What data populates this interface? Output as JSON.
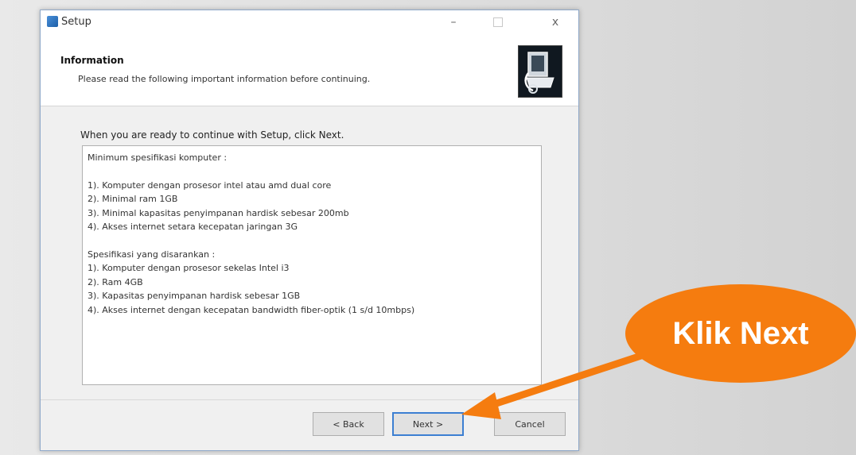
{
  "window": {
    "title": "Setup",
    "minimize": "–",
    "close": "x"
  },
  "header": {
    "title": "Information",
    "subtitle": "Please read the following important information before continuing."
  },
  "body": {
    "instruction": "When you are ready to continue with Setup, click Next.",
    "info_lines": [
      "Minimum spesifikasi komputer :",
      "",
      "1). Komputer dengan prosesor intel atau amd dual core",
      "2). Minimal ram 1GB",
      "3). Minimal kapasitas penyimpanan hardisk sebesar 200mb",
      "4). Akses internet setara kecepatan jaringan 3G",
      "",
      "Spesifikasi yang disarankan :",
      "1). Komputer dengan prosesor sekelas Intel i3",
      "2). Ram 4GB",
      "3). Kapasitas penyimpanan hardisk sebesar 1GB",
      "4). Akses internet dengan kecepatan bandwidth fiber-optik (1 s/d 10mbps)"
    ]
  },
  "buttons": {
    "back": "< Back",
    "next": "Next >",
    "cancel": "Cancel"
  },
  "callout": {
    "text": "Klik Next",
    "color": "#f57c0f"
  }
}
